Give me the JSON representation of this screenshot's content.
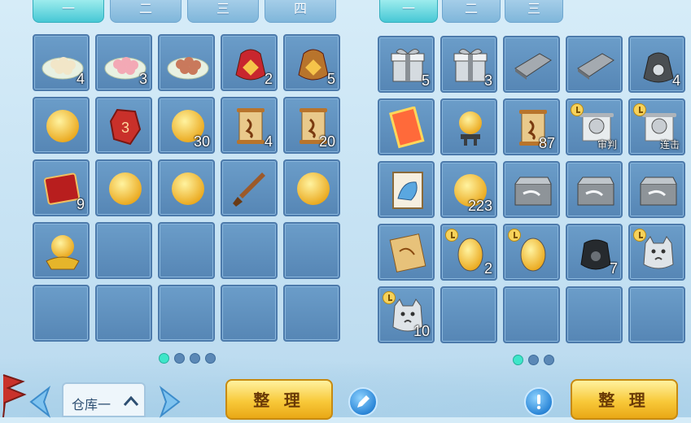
{
  "left_tabs": [
    "一",
    "二",
    "三",
    "四"
  ],
  "right_tabs": [
    "一",
    "二",
    "三"
  ],
  "left_items": [
    {
      "icon": "dumplings-plate-icon",
      "count": "4"
    },
    {
      "icon": "pink-dumplings-plate-icon",
      "count": "3"
    },
    {
      "icon": "meatballs-plate-icon",
      "count": ""
    },
    {
      "icon": "red-lucky-bag-icon",
      "count": "2"
    },
    {
      "icon": "gold-lucky-bag-icon",
      "count": "5"
    },
    {
      "icon": "golden-lightning-orb-icon",
      "count": ""
    },
    {
      "icon": "red-stone-icon",
      "count": ""
    },
    {
      "icon": "blue-swirl-orb-icon",
      "count": "30"
    },
    {
      "icon": "scroll-icon",
      "count": "4"
    },
    {
      "icon": "scroll-icon",
      "count": "20"
    },
    {
      "icon": "red-book-icon",
      "count": "9"
    },
    {
      "icon": "red-orb-icon",
      "count": ""
    },
    {
      "icon": "purple-orb-icon",
      "count": ""
    },
    {
      "icon": "sword-icon",
      "count": ""
    },
    {
      "icon": "golden-fire-orb-icon",
      "count": ""
    },
    {
      "icon": "purple-crystal-ball-pedestal-icon",
      "count": ""
    }
  ],
  "right_items": [
    {
      "icon": "silver-gift-box-icon",
      "count": "5",
      "label": "",
      "timed": false
    },
    {
      "icon": "silver-gift-box-icon",
      "count": "3",
      "label": "",
      "timed": false
    },
    {
      "icon": "silver-ingot-bar-icon",
      "count": "",
      "label": "",
      "timed": false
    },
    {
      "icon": "silver-ingot-small-icon",
      "count": "",
      "label": "",
      "timed": false
    },
    {
      "icon": "silver-money-bag-icon",
      "count": "4",
      "label": "",
      "timed": false
    },
    {
      "icon": "glowing-talisman-icon",
      "count": "",
      "label": "",
      "timed": false
    },
    {
      "icon": "crystal-ball-stand-icon",
      "count": "",
      "label": "",
      "timed": false
    },
    {
      "icon": "parchment-scroll-icon",
      "count": "87",
      "label": "",
      "timed": false
    },
    {
      "icon": "map-scroll-icon",
      "count": "",
      "label": "审判",
      "timed": true
    },
    {
      "icon": "map-scroll-icon",
      "count": "",
      "label": "连击",
      "timed": true
    },
    {
      "icon": "ice-beast-card-icon",
      "count": "",
      "label": "",
      "timed": false
    },
    {
      "icon": "pink-orb-icon",
      "count": "223",
      "label": "",
      "timed": false
    },
    {
      "icon": "ink-tablet-icon",
      "count": "",
      "label": "",
      "timed": false
    },
    {
      "icon": "ink-tablet-icon",
      "count": "",
      "label": "",
      "timed": false
    },
    {
      "icon": "ink-tablet-icon",
      "count": "",
      "label": "",
      "timed": false
    },
    {
      "icon": "treasure-map-icon",
      "count": "",
      "label": "",
      "timed": false
    },
    {
      "icon": "silver-egg-icon",
      "count": "2",
      "label": "",
      "timed": true
    },
    {
      "icon": "silver-egg-icon",
      "count": "",
      "label": "",
      "timed": true
    },
    {
      "icon": "black-pot-icon",
      "count": "7",
      "label": "",
      "timed": false
    },
    {
      "icon": "silver-cat-pouch-icon",
      "count": "",
      "label": "",
      "timed": true
    },
    {
      "icon": "cat-scroll-icon",
      "count": "10",
      "label": "",
      "timed": true
    }
  ],
  "left_pagination": {
    "pages": 4,
    "current": 1
  },
  "right_pagination": {
    "pages": 3,
    "current": 1
  },
  "warehouse": {
    "selected": "仓库一"
  },
  "buttons": {
    "sort_left": "整 理",
    "sort_right": "整 理"
  },
  "icons": {
    "prev": "left-arrow-icon",
    "next": "right-arrow-icon",
    "edit": "pencil-icon",
    "info": "exclamation-icon",
    "dropdown": "chevron-up-icon"
  },
  "colors": {
    "slot_bg": "#5f91c1",
    "active_tab": "#47c8d5",
    "sort_button": "#f8c93a",
    "page_dot_active": "#3ee6c9"
  }
}
